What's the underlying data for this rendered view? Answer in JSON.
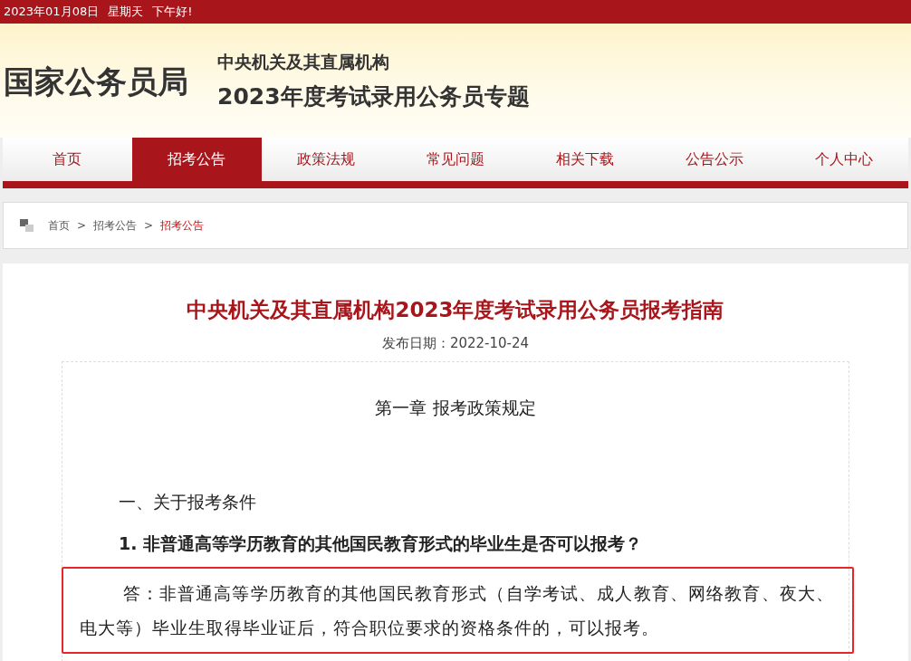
{
  "top_bar": {
    "date": "2023年01月08日",
    "weekday": "星期天",
    "greeting": "下午好!"
  },
  "header": {
    "logo": "国家公务员局",
    "subtitle": "中央机关及其直属机构",
    "title": "2023年度考试录用公务员专题"
  },
  "nav": [
    {
      "label": "首页",
      "selected": false
    },
    {
      "label": "招考公告",
      "selected": true
    },
    {
      "label": "政策法规",
      "selected": false
    },
    {
      "label": "常见问题",
      "selected": false
    },
    {
      "label": "相关下载",
      "selected": false
    },
    {
      "label": "公告公示",
      "selected": false
    },
    {
      "label": "个人中心",
      "selected": false
    }
  ],
  "breadcrumb": [
    {
      "label": "首页",
      "selected": false
    },
    {
      "label": "招考公告",
      "selected": false
    },
    {
      "label": "招考公告",
      "selected": true
    }
  ],
  "breadcrumb_separator": ">",
  "article": {
    "title": "中央机关及其直属机构2023年度考试录用公务员报考指南",
    "date": "发布日期：2022-10-24",
    "chapter": "第一章  报考政策规定",
    "section": "一、关于报考条件",
    "question": "1. 非普通高等学历教育的其他国民教育形式的毕业生是否可以报考？",
    "answer": "答：非普通高等学历教育的其他国民教育形式（自学考试、成人教育、网络教育、夜大、电大等）毕业生取得毕业证后，符合职位要求的资格条件的，可以报考。"
  }
}
